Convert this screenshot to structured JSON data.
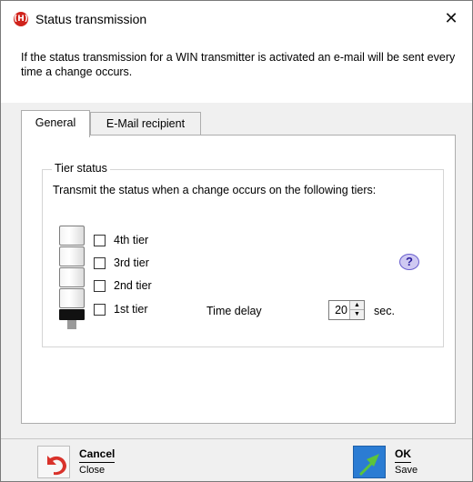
{
  "window": {
    "title": "Status transmission",
    "close_glyph": "✕",
    "app_icon_glyph": "(H)"
  },
  "info": {
    "text": "If the status transmission for a WIN transmitter is activated an e-mail will be sent every time a change occurs."
  },
  "tabs": [
    {
      "label": "General",
      "active": true
    },
    {
      "label": "E-Mail recipient",
      "active": false
    }
  ],
  "tier_status": {
    "group_label": "Tier status",
    "instruction": "Transmit the status when a change occurs on the following tiers:",
    "tiers": [
      {
        "label": "4th tier",
        "checked": false
      },
      {
        "label": "3rd tier",
        "checked": false
      },
      {
        "label": "2nd tier",
        "checked": false
      },
      {
        "label": "1st tier",
        "checked": false
      }
    ],
    "help_glyph": "?",
    "time_delay_label": "Time delay",
    "time_delay_value": "20",
    "time_delay_unit": "sec."
  },
  "footer": {
    "cancel": {
      "label": "Cancel",
      "sub": "Close",
      "icon": "undo-arrow-icon"
    },
    "ok": {
      "label": "OK",
      "sub": "Save",
      "icon": "check-arrow-icon"
    }
  },
  "colors": {
    "brand_red": "#d0231c",
    "ok_blue": "#2b7cd3",
    "ok_green_arrow": "#5cc43a",
    "help_purple": "#6a5fcf"
  }
}
